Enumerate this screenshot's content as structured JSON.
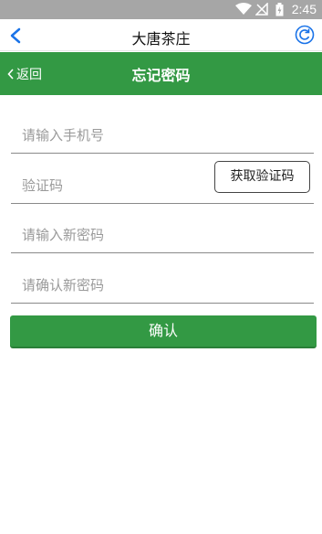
{
  "status_bar": {
    "time": "2:45",
    "icons": [
      "wifi-icon",
      "no-signal-icon",
      "battery-icon"
    ]
  },
  "browser_bar": {
    "title": "大唐茶庄",
    "back_icon": "chevron-left-icon",
    "refresh_icon": "refresh-icon"
  },
  "header": {
    "back_label": "返回",
    "title": "忘记密码"
  },
  "form": {
    "phone_placeholder": "请输入手机号",
    "code_placeholder": "验证码",
    "get_code_label": "获取验证码",
    "new_password_placeholder": "请输入新密码",
    "confirm_password_placeholder": "请确认新密码",
    "submit_label": "确认"
  },
  "colors": {
    "header_green": "#339944",
    "status_bar": "#a6a6a6",
    "accent_blue": "#1a73e8"
  }
}
